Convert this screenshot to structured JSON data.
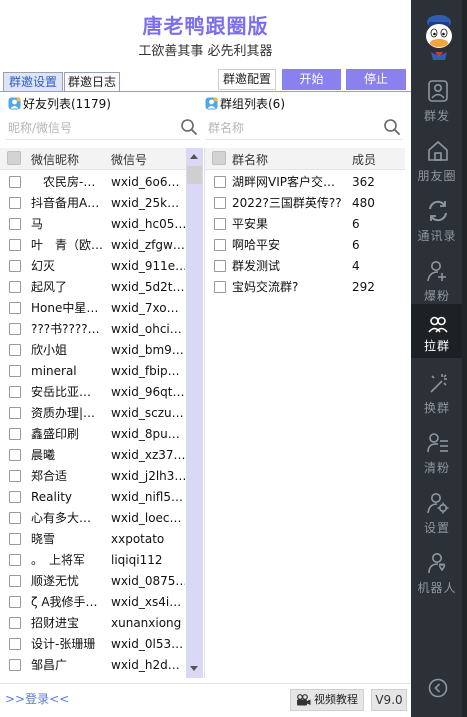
{
  "app": {
    "title": "唐老鸭跟圈版",
    "slogan": "工欲善其事 必先利其器"
  },
  "tabs": [
    {
      "label": "群邀设置",
      "active": true
    },
    {
      "label": "群邀日志",
      "active": false
    }
  ],
  "toolbar": {
    "config_label": "群邀配置",
    "start_label": "开始",
    "stop_label": "停止"
  },
  "friends": {
    "title": "好友列表(1179)",
    "search_placeholder": "昵称/微信号",
    "col_nickname": "微信昵称",
    "col_wxid": "微信号",
    "rows": [
      {
        "name": "　农民房-…",
        "id": "wxid_6o6…"
      },
      {
        "name": "抖音备用A…",
        "id": "wxid_25k…"
      },
      {
        "name": "马",
        "id": "wxid_hc05…"
      },
      {
        "name": "叶　青（欧…",
        "id": "wxid_zfgw…"
      },
      {
        "name": "幻灭",
        "id": "wxid_911e…"
      },
      {
        "name": "起风了",
        "id": "wxid_5d2t…"
      },
      {
        "name": "Hone中星…",
        "id": "wxid_7xo…"
      },
      {
        "name": "???书????…",
        "id": "wxid_ohci…"
      },
      {
        "name": "欣小姐",
        "id": "wxid_bm9…"
      },
      {
        "name": "mineral",
        "id": "wxid_fbip…"
      },
      {
        "name": "安岳比亚…",
        "id": "wxid_96qt…"
      },
      {
        "name": "资质办理|…",
        "id": "wxid_sczu…"
      },
      {
        "name": "鑫盛印刷",
        "id": "wxid_8pu…"
      },
      {
        "name": "晨曦",
        "id": "wxid_xz37…"
      },
      {
        "name": "郑合适",
        "id": "wxid_j2lh3…"
      },
      {
        "name": "Reality",
        "id": "wxid_nifl5…"
      },
      {
        "name": "心有多大…",
        "id": "wxid_loec…"
      },
      {
        "name": "晓雪",
        "id": "xxpotato"
      },
      {
        "name": "。　上将军",
        "id": "liqiqi112"
      },
      {
        "name": "顺遂无忧",
        "id": "wxid_0875…"
      },
      {
        "name": "ζ A我修手…",
        "id": "wxid_xs4i…"
      },
      {
        "name": "招财进宝",
        "id": "xunanxiong"
      },
      {
        "name": "设计-张珊珊",
        "id": "wxid_0l53…"
      },
      {
        "name": "邹昌广",
        "id": "wxid_h2d…"
      }
    ]
  },
  "groups": {
    "title": "群组列表(6)",
    "search_placeholder": "群名称",
    "col_name": "群名称",
    "col_members": "成员",
    "rows": [
      {
        "name": "湖畔网VIP客户交…",
        "members": "362"
      },
      {
        "name": "2022?三国群英传??",
        "members": "480"
      },
      {
        "name": "平安果",
        "members": "6"
      },
      {
        "name": "啊哈平安",
        "members": "6"
      },
      {
        "name": "群发测试",
        "members": "4"
      },
      {
        "name": "宝妈交流群?",
        "members": "292"
      }
    ]
  },
  "footer": {
    "login_label": ">>登录<<",
    "video_label": "视频教程",
    "version": "V9.0"
  },
  "sidebar": {
    "items": [
      {
        "label": "群发",
        "icon": "person-send-icon"
      },
      {
        "label": "朋友圈",
        "icon": "home-icon"
      },
      {
        "label": "通讯录",
        "icon": "refresh-icon"
      },
      {
        "label": "爆粉",
        "icon": "add-user-icon"
      },
      {
        "label": "拉群",
        "icon": "group-icon",
        "active": true
      },
      {
        "label": "换群",
        "icon": "sparkle-icon"
      },
      {
        "label": "清粉",
        "icon": "user-list-icon"
      },
      {
        "label": "设置",
        "icon": "user-gear-icon"
      },
      {
        "label": "机器人",
        "icon": "robot-user-icon"
      }
    ]
  },
  "colors": {
    "accent": "#8b81ee",
    "title": "#7b6ff0",
    "sidebar_bg": "#2b3137",
    "active_indicator": "#3d7bd4"
  }
}
